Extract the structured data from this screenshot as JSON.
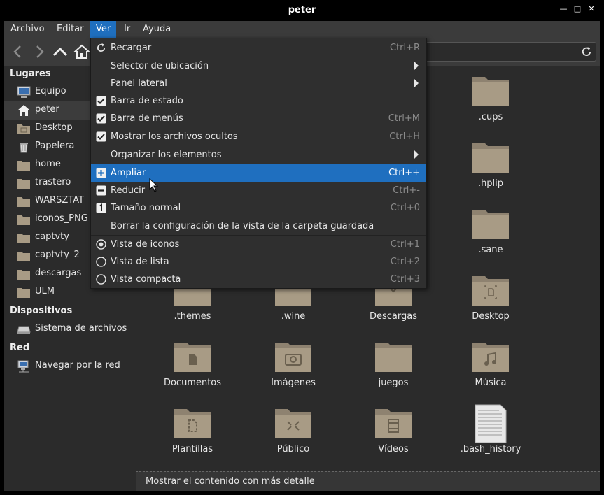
{
  "window": {
    "title": "peter"
  },
  "menubar": [
    "Archivo",
    "Editar",
    "Ver",
    "Ir",
    "Ayuda"
  ],
  "sidebar": {
    "places_title": "Lugares",
    "places": [
      "Equipo",
      "peter",
      "Desktop",
      "Papelera",
      "home",
      "trastero",
      "WARSZTAT",
      "iconos_PNG",
      "captvty",
      "captvty_2",
      "descargas",
      "ULM"
    ],
    "devices_title": "Dispositivos",
    "devices": [
      "Sistema de archivos"
    ],
    "network_title": "Red",
    "network": [
      "Navegar por la red"
    ]
  },
  "files": [
    ".cups",
    ".hplip",
    ".sane",
    ".themes",
    ".wine",
    "Descargas",
    "Desktop",
    "Documentos",
    "Imágenes",
    "juegos",
    "Música",
    "Plantillas",
    "Público",
    "Vídeos",
    ".bash_history"
  ],
  "view_menu": {
    "items": [
      {
        "label": "Recargar",
        "shortcut": "Ctrl+R",
        "icon": "reload-icon"
      },
      {
        "label": "Selector de ubicación",
        "submenu": true
      },
      {
        "label": "Panel lateral",
        "submenu": true
      },
      {
        "label": "Barra de estado",
        "checked": true
      },
      {
        "label": "Barra de menús",
        "shortcut": "Ctrl+M",
        "checked": true
      },
      {
        "label": "Mostrar los archivos ocultos",
        "shortcut": "Ctrl+H",
        "checked": true
      },
      {
        "label": "Organizar los elementos",
        "submenu": true
      },
      {
        "label": "Ampliar",
        "shortcut": "Ctrl++",
        "icon": "zoom-in-icon",
        "highlighted": true
      },
      {
        "label": "Reducir",
        "shortcut": "Ctrl+-",
        "icon": "zoom-out-icon"
      },
      {
        "label": "Tamaño normal",
        "shortcut": "Ctrl+0",
        "icon": "zoom-normal-icon"
      },
      {
        "label": "Borrar la configuración de la vista de la carpeta guardada"
      },
      {
        "label": "Vista de iconos",
        "shortcut": "Ctrl+1",
        "radio": true,
        "selected": true
      },
      {
        "label": "Vista de lista",
        "shortcut": "Ctrl+2",
        "radio": true
      },
      {
        "label": "Vista compacta",
        "shortcut": "Ctrl+3",
        "radio": true
      }
    ]
  },
  "statusbar": {
    "text": "Mostrar el contenido con más detalle"
  },
  "colors": {
    "accent": "#1f6fbf",
    "folder": "#a89b85",
    "background": "#2b2b2b"
  }
}
